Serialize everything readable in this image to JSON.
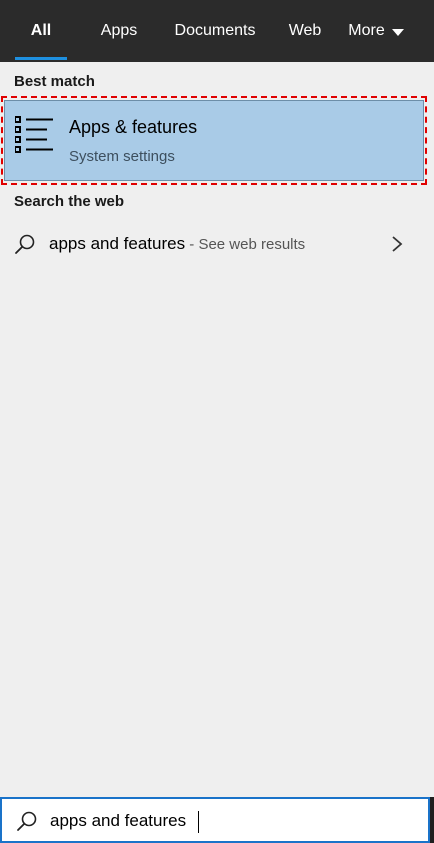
{
  "tabs": [
    {
      "label": "All",
      "active": true
    },
    {
      "label": "Apps",
      "active": false
    },
    {
      "label": "Documents",
      "active": false
    },
    {
      "label": "Web",
      "active": false
    },
    {
      "label": "More",
      "active": false
    }
  ],
  "best_match": {
    "section_title": "Best match",
    "title": "Apps & features",
    "subtitle": "System settings",
    "icon": "list-icon"
  },
  "search_web": {
    "section_title": "Search the web",
    "query": "apps and features",
    "hint": " - See web results",
    "icon": "search-icon",
    "chevron": "chevron-right-icon"
  },
  "search_box": {
    "value": "apps and features",
    "icon": "search-icon"
  },
  "colors": {
    "tabbar_bg": "#2b2b2b",
    "accent": "#1e90e0",
    "selection_bg": "#a9cbe7",
    "highlight_outline": "#e00000",
    "panel_bg": "#efefef"
  }
}
